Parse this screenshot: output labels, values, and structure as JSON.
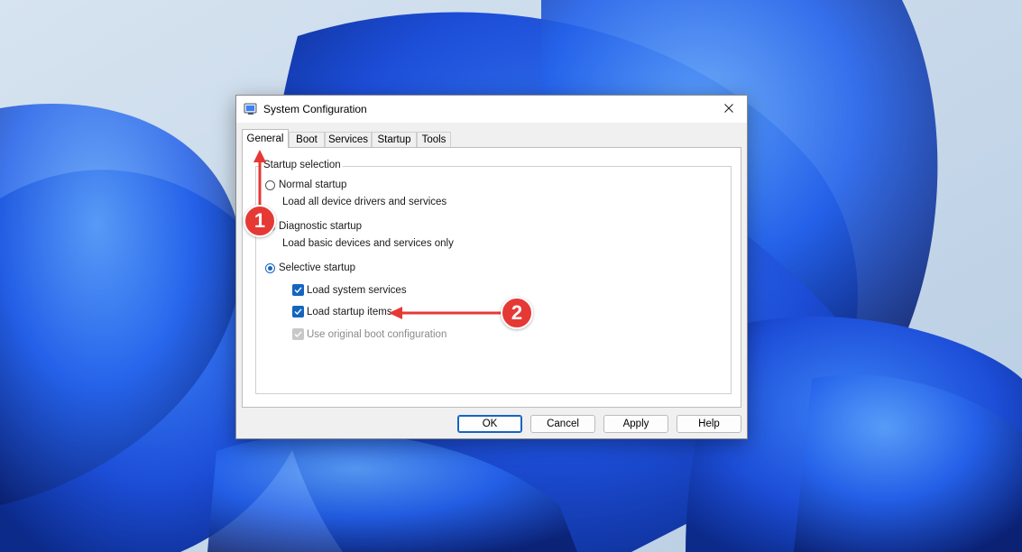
{
  "window": {
    "title": "System Configuration",
    "icon": "system-config-icon",
    "close_icon": "close-icon"
  },
  "tabs": [
    {
      "label": "General",
      "active": true
    },
    {
      "label": "Boot",
      "active": false
    },
    {
      "label": "Services",
      "active": false
    },
    {
      "label": "Startup",
      "active": false
    },
    {
      "label": "Tools",
      "active": false
    }
  ],
  "startup_selection": {
    "legend": "Startup selection",
    "normal": {
      "label": "Normal startup",
      "description": "Load all device drivers and services",
      "checked": false
    },
    "diagnostic": {
      "label": "Diagnostic startup",
      "description": "Load basic devices and services only",
      "checked": false
    },
    "selective": {
      "label": "Selective startup",
      "checked": true,
      "options": [
        {
          "label": "Load system services",
          "checked": true,
          "disabled": false
        },
        {
          "label": "Load startup items",
          "checked": true,
          "disabled": false
        },
        {
          "label": "Use original boot configuration",
          "checked": true,
          "disabled": true
        }
      ]
    }
  },
  "buttons": {
    "ok": "OK",
    "cancel": "Cancel",
    "apply": "Apply",
    "help": "Help"
  },
  "annotations": {
    "badge1": "1",
    "badge2": "2",
    "color": "#e53935"
  },
  "colors": {
    "accent": "#1565c0",
    "wallpaper_bg": "#c9d9ea",
    "wallpaper_blue": "#1a56db"
  }
}
